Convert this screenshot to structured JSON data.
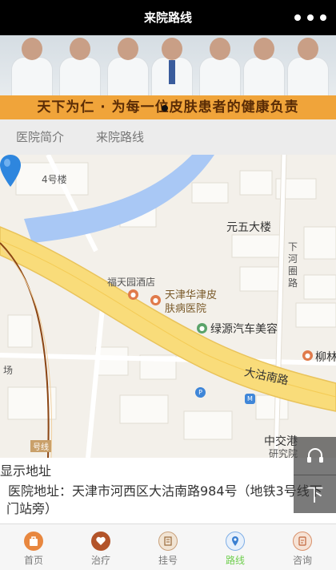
{
  "header": {
    "title": "来院路线",
    "more_icon": "more-dots-icon"
  },
  "banner": {
    "slogan": "天下为仁 · 为每一位皮肤患者的健康负责",
    "accent": "#f0a43a"
  },
  "tabs": [
    {
      "label": "医院简介"
    },
    {
      "label": "来院路线"
    }
  ],
  "map": {
    "labels": {
      "building4": "4号楼",
      "yuanwu": "元五大楼",
      "xiahe": "下河圈路",
      "futian": "福天园酒店",
      "hospital": "天津华津皮肤病医院",
      "lvyuan": "绿源汽车美容",
      "liu": "柳林",
      "dagunan": "大沽南路",
      "chang": "场",
      "line": "号线",
      "zhongjiao": "中交港",
      "yanjiusuo": "研究院"
    },
    "road_color": "#f9dc7a",
    "river_color": "#a9c8f5"
  },
  "float_buttons": {
    "service_icon": "headset-icon",
    "top_label": "下"
  },
  "address": {
    "title": "显示地址",
    "text": "医院地址：天津市河西区大沽南路984号（地铁3号线下门站旁）"
  },
  "bottom_nav": [
    {
      "label": "首页",
      "icon": "home-bag-icon"
    },
    {
      "label": "治疗",
      "icon": "heart-icon"
    },
    {
      "label": "挂号",
      "icon": "register-icon"
    },
    {
      "label": "路线",
      "icon": "location-pin-icon"
    },
    {
      "label": "咨询",
      "icon": "consult-icon"
    }
  ]
}
